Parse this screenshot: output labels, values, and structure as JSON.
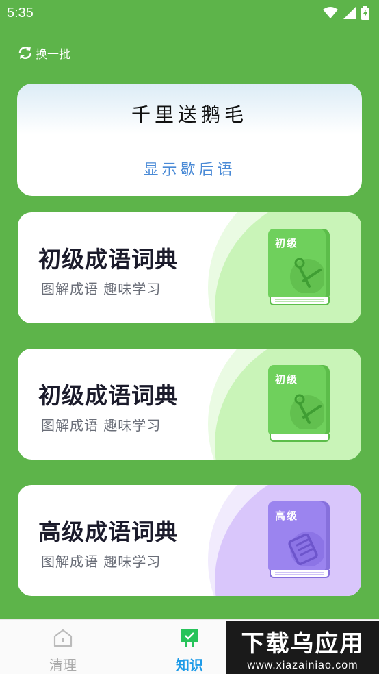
{
  "status_bar": {
    "time": "5:35"
  },
  "refresh": {
    "label": "换一批",
    "icon": "refresh-icon"
  },
  "riddle": {
    "text": "千里送鹅毛",
    "action": "显示歇后语"
  },
  "dictionaries": [
    {
      "title": "初级成语词典",
      "subtitle": "图解成语 趣味学习",
      "book_label": "初级",
      "theme": "green",
      "icon": "compass-icon"
    },
    {
      "title": "初级成语词典",
      "subtitle": "图解成语 趣味学习",
      "book_label": "初级",
      "theme": "green",
      "icon": "compass-icon"
    },
    {
      "title": "高级成语词典",
      "subtitle": "图解成语 趣味学习",
      "book_label": "高级",
      "theme": "purple",
      "icon": "notebook-icon"
    }
  ],
  "tabs": [
    {
      "label": "清理",
      "icon": "home-icon",
      "active": false
    },
    {
      "label": "知识",
      "icon": "knowledge-icon",
      "active": true
    }
  ],
  "watermark": {
    "big": "下载乌应用",
    "url": "www.xiazainiao.com"
  },
  "colors": {
    "background": "#5db44a",
    "accent_blue": "#1e9be8",
    "link_blue": "#4a8ad6",
    "green_book": "#6fd05c",
    "purple_book": "#9b84ef"
  }
}
